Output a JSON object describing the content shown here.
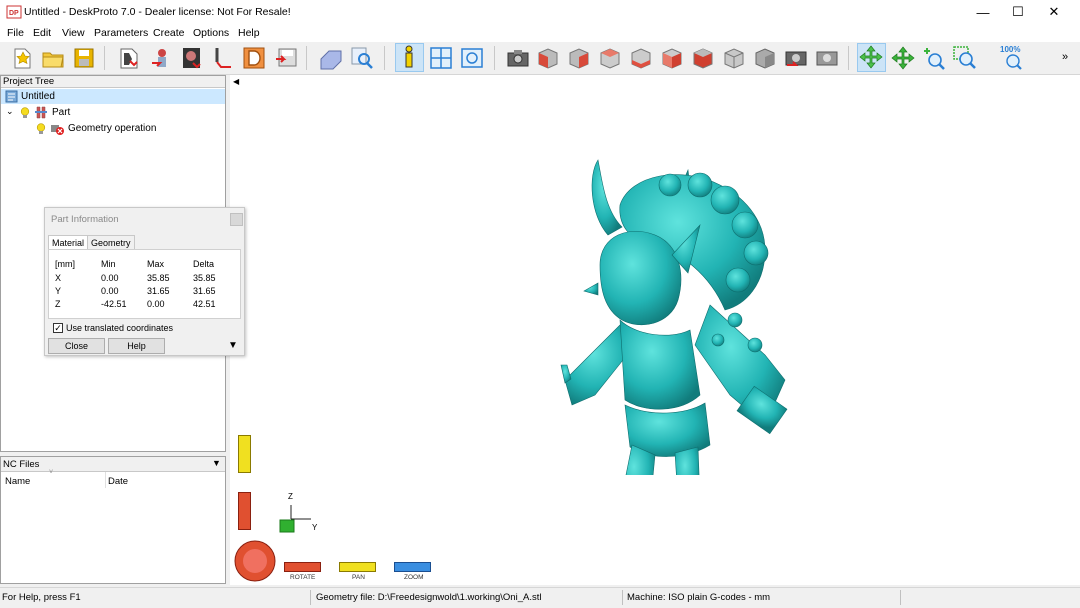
{
  "window": {
    "title": "Untitled - DeskProto 7.0 - Dealer license: Not For Resale!",
    "icon_text": "DP"
  },
  "menu": [
    "File",
    "Edit",
    "View",
    "Parameters",
    "Create",
    "Options",
    "Help"
  ],
  "toolbar": {
    "zoom_level": "100%",
    "more_label": "»",
    "icons": [
      "new-file-icon",
      "open-folder-icon",
      "save-icon",
      "import-geometry-icon",
      "part-icon",
      "bitmap-icon",
      "vector-icon",
      "drawing-icon",
      "export-icon",
      "geometry-icon",
      "search-icon",
      "info-icon",
      "layout-icon",
      "preview-icon",
      "camera-icon",
      "cube-view-icon",
      "cube-view-icon",
      "cube-view-icon",
      "cube-view-icon",
      "cube-view-icon",
      "cube-view-icon",
      "cube-view-icon",
      "cube-view-icon",
      "camera-icon",
      "camera-icon",
      "rotate-view-icon",
      "pan-icon",
      "zoom-in-icon",
      "zoom-window-icon",
      "zoom-100-icon"
    ]
  },
  "project_tree": {
    "header": "Project Tree",
    "root": "Untitled",
    "part": "Part",
    "operation": "Geometry operation"
  },
  "part_info": {
    "title": "Part Information",
    "tabs": [
      "Material",
      "Geometry"
    ],
    "columns": [
      "[mm]",
      "Min",
      "Max",
      "Delta"
    ],
    "rows": [
      [
        "X",
        "0.00",
        "35.85",
        "35.85"
      ],
      [
        "Y",
        "0.00",
        "31.65",
        "31.65"
      ],
      [
        "Z",
        "-42.51",
        "0.00",
        "42.51"
      ]
    ],
    "checkbox_label": "Use translated coordinates",
    "checkbox_checked": true,
    "close_label": "Close",
    "help_label": "Help"
  },
  "nc_files": {
    "header": "NC Files",
    "columns": [
      "Name",
      "Date"
    ]
  },
  "viewport": {
    "axis_z": "Z",
    "axis_y": "Y",
    "rotate_label": "ROTATE",
    "pan_label": "PAN",
    "zoom_label": "ZOOM",
    "model_color": "#22b4b4"
  },
  "status": {
    "help": "For Help, press F1",
    "geometry_file": "Geometry file: D:\\Freedesignwold\\1.working\\Oni_A.stl",
    "machine": "Machine: ISO plain G-codes - mm"
  }
}
